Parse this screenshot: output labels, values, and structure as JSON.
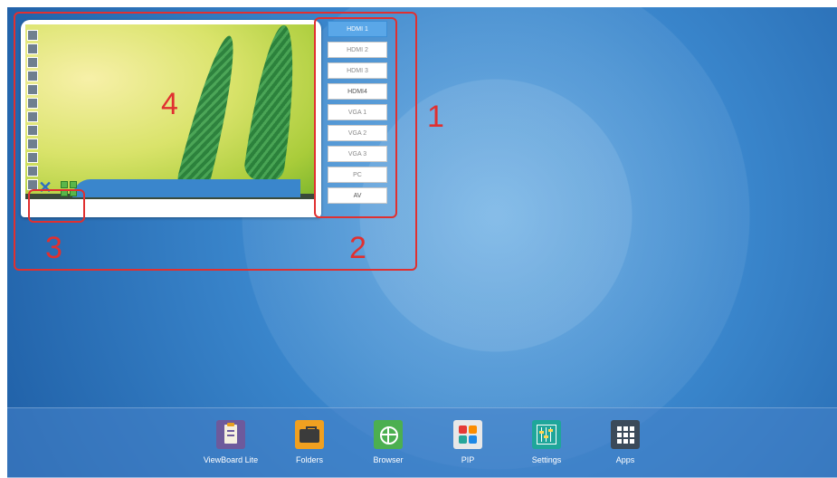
{
  "pip": {
    "controls": {
      "close_icon": "close-x-icon",
      "fullscreen_icon": "fullscreen-arrows-icon"
    }
  },
  "sources": [
    {
      "label": "HDMI 1",
      "active": true
    },
    {
      "label": "HDMI 2",
      "active": false
    },
    {
      "label": "HDMI 3",
      "active": false
    },
    {
      "label": "HDMI4",
      "active": false
    },
    {
      "label": "VGA 1",
      "active": false
    },
    {
      "label": "VGA 2",
      "active": false
    },
    {
      "label": "VGA 3",
      "active": false
    },
    {
      "label": "PC",
      "active": false
    },
    {
      "label": "AV",
      "active": false
    }
  ],
  "annotations": [
    "1",
    "2",
    "3",
    "4"
  ],
  "dock": [
    {
      "label": "ViewBoard Lite",
      "icon": "clipboard-icon",
      "color": "#7b5ea7"
    },
    {
      "label": "Folders",
      "icon": "briefcase-icon",
      "color": "#f0a020"
    },
    {
      "label": "Browser",
      "icon": "globe-icon",
      "color": "#4caf50"
    },
    {
      "label": "PIP",
      "icon": "pip-grid-icon",
      "color": "#e8e8e8"
    },
    {
      "label": "Settings",
      "icon": "sliders-icon",
      "color": "#1fa69a"
    },
    {
      "label": "Apps",
      "icon": "apps-grid-icon",
      "color": "#3b4a5a"
    }
  ]
}
